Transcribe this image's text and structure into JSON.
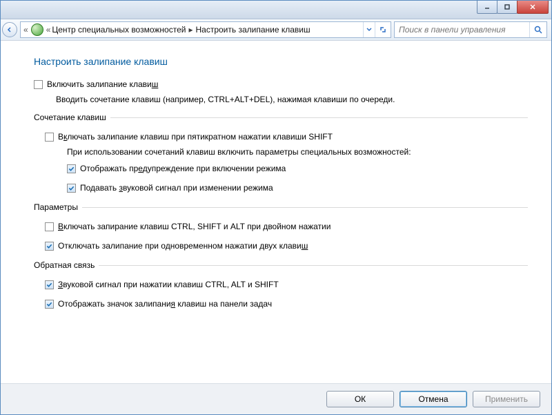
{
  "breadcrumb": {
    "item1": "Центр специальных возможностей",
    "item2": "Настроить залипание клавиш"
  },
  "search": {
    "placeholder": "Поиск в панели управления"
  },
  "page": {
    "title": "Настроить залипание клавиш",
    "enable_label_pre": "Включить залипание клави",
    "enable_label_ul": "ш",
    "enable_label_post": "",
    "enable_hint": "Вводить сочетание клавиш (например, CTRL+ALT+DEL), нажимая клавиши по очереди."
  },
  "group_shortcut": {
    "legend": "Сочетание клавиш",
    "five_shift_pre": "В",
    "five_shift_ul": "к",
    "five_shift_post": "лючать залипание клавиш при пятикратном нажатии клавиши SHIFT",
    "note": "При использовании сочетаний клавиш включить параметры специальных возможностей:",
    "warn_pre": "Отображать пр",
    "warn_ul": "е",
    "warn_post": "дупреждение при включении режима",
    "sound_pre": "Подавать ",
    "sound_ul": "з",
    "sound_post": "вуковой сигнал при изменении режима"
  },
  "group_params": {
    "legend": "Параметры",
    "lock_pre": "",
    "lock_ul": "В",
    "lock_post": "ключать запирание клавиш CTRL, SHIFT и ALT при двойном нажатии",
    "off_pre": "Отключать залипание при одновременном нажатии двух клави",
    "off_ul": "ш",
    "off_post": ""
  },
  "group_feedback": {
    "legend": "Обратная связь",
    "beep_pre": "",
    "beep_ul": "З",
    "beep_post": "вуковой сигнал при нажатии клавиш CTRL, ALT и SHIFT",
    "tray_pre": "Отображать значок залипани",
    "tray_ul": "я",
    "tray_post": " клавиш на панели задач"
  },
  "buttons": {
    "ok_ul": "О",
    "ok_post": "К",
    "cancel": "Отмена",
    "apply_pre": "При",
    "apply_ul": "м",
    "apply_post": "енить"
  },
  "state": {
    "enable": false,
    "five_shift": false,
    "warn": true,
    "sound": true,
    "lock": false,
    "off_two": true,
    "beep": true,
    "tray": true
  }
}
